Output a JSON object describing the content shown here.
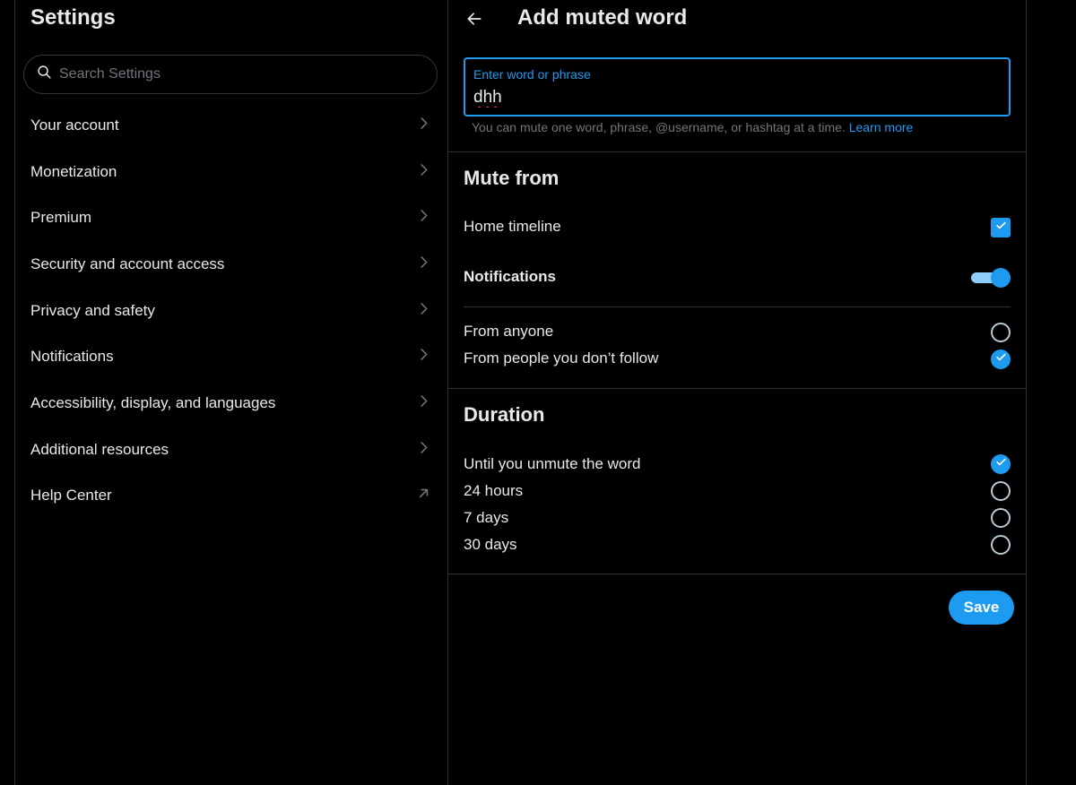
{
  "settings": {
    "title": "Settings",
    "search_placeholder": "Search Settings",
    "items": [
      {
        "label": "Your account"
      },
      {
        "label": "Monetization"
      },
      {
        "label": "Premium"
      },
      {
        "label": "Security and account access"
      },
      {
        "label": "Privacy and safety"
      },
      {
        "label": "Notifications"
      },
      {
        "label": "Accessibility, display, and languages"
      },
      {
        "label": "Additional resources"
      },
      {
        "label": "Help Center"
      }
    ]
  },
  "muted_word": {
    "title": "Add muted word",
    "input_label": "Enter word or phrase",
    "input_value": "dhh",
    "help_text": "You can mute one word, phrase, @username, or hashtag at a time.",
    "learn_more": "Learn more",
    "mute_from": {
      "title": "Mute from",
      "home_timeline": {
        "label": "Home timeline",
        "checked": true
      },
      "notifications": {
        "label": "Notifications",
        "enabled": true
      },
      "options": [
        {
          "label": "From anyone",
          "selected": false
        },
        {
          "label": "From people you don’t follow",
          "selected": true
        }
      ]
    },
    "duration": {
      "title": "Duration",
      "options": [
        {
          "label": "Until you unmute the word",
          "selected": true
        },
        {
          "label": "24 hours",
          "selected": false
        },
        {
          "label": "7 days",
          "selected": false
        },
        {
          "label": "30 days",
          "selected": false
        }
      ]
    },
    "save_label": "Save"
  },
  "colors": {
    "accent": "#1d9bf0",
    "background": "#000000",
    "text": "#e7e9ea",
    "muted_text": "#71767b",
    "divider": "#2f3336"
  },
  "icons": {
    "search": "search-icon",
    "chevron": "chevron-right-icon",
    "external": "external-link-icon",
    "back": "back-arrow-icon",
    "check": "checkmark-icon"
  }
}
